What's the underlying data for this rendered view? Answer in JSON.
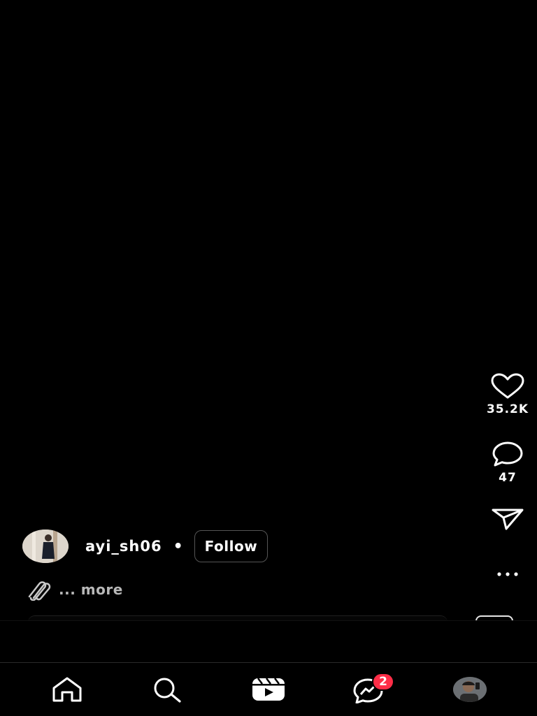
{
  "actions": {
    "like_count": "35.2K",
    "comment_count": "47"
  },
  "author": {
    "username": "ayi_sh06",
    "separator": "•",
    "follow_label": "Follow"
  },
  "caption": {
    "icon": "paperclip-icon",
    "more_label": "... more"
  },
  "tabbar": {
    "tabs": [
      {
        "icon": "home-icon"
      },
      {
        "icon": "search-icon"
      },
      {
        "icon": "reels-icon"
      },
      {
        "icon": "messenger-icon",
        "badge": "2"
      },
      {
        "icon": "profile-avatar"
      }
    ]
  },
  "colors": {
    "background": "#000000",
    "badge": "#ff2d47",
    "muted_text": "#b8b8b8"
  }
}
